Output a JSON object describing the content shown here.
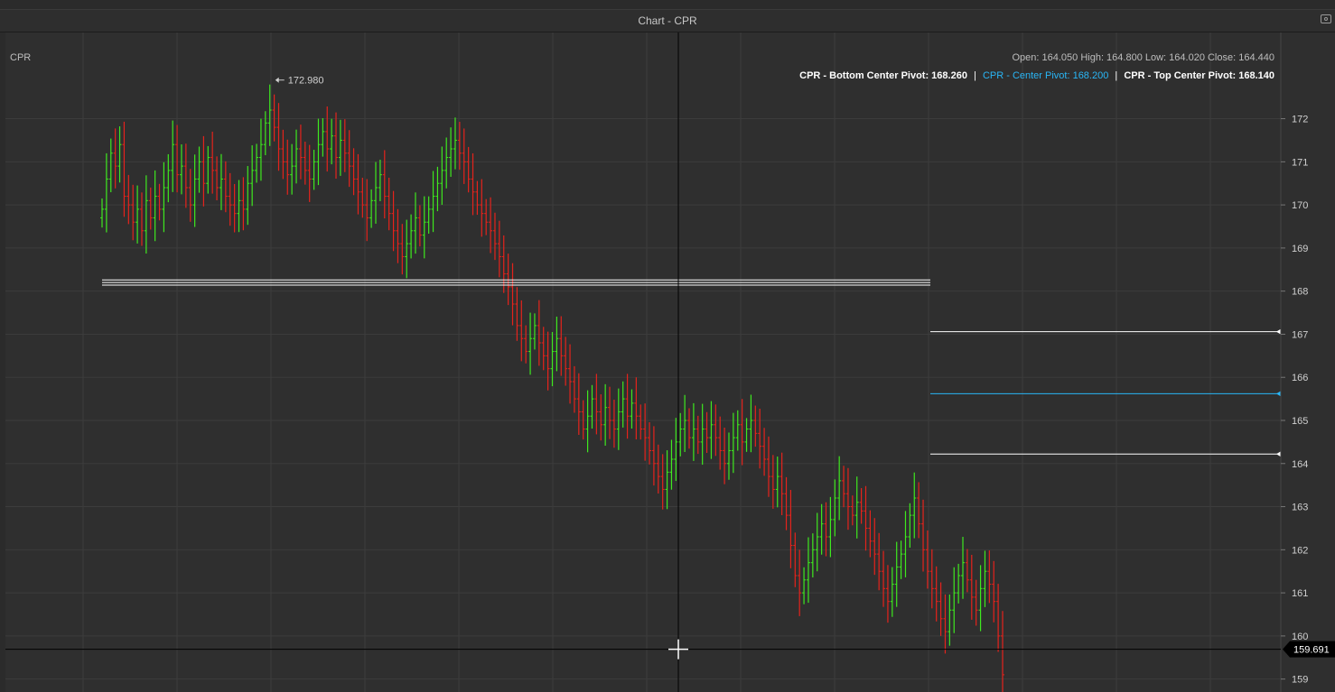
{
  "window": {
    "title": "Chart - CPR",
    "screenshot_icon": "camera-icon"
  },
  "legend": {
    "name": "CPR",
    "ohlc": "Open: 164.050 High: 164.800 Low: 164.020 Close: 164.440",
    "bottom_pivot": "CPR - Bottom Center Pivot: 168.260",
    "center_pivot": "CPR - Center Pivot: 168.200",
    "top_pivot": "CPR - Top Center Pivot: 168.140",
    "separator": "|"
  },
  "colors": {
    "up": "#3ee81f",
    "down": "#e5231c",
    "white_line": "#ffffff",
    "blue_line": "#29b6f6",
    "grid": "#3c3c3c",
    "background": "#2f2f2f"
  },
  "chart_data": {
    "type": "candlestick-ohlc",
    "title": "",
    "y_ticks": [
      172,
      171,
      170,
      169,
      168,
      167,
      166,
      165,
      164,
      163,
      162,
      161,
      160,
      159
    ],
    "y_range": [
      158.7,
      174.0
    ],
    "annotations": {
      "high_marker": "172.980"
    },
    "cursor": {
      "price_label": "159.691",
      "price": 159.691
    },
    "pivot_lines_current": [
      {
        "name": "CPR - Bottom Center Pivot",
        "value": 168.26,
        "color": "#ffffff"
      },
      {
        "name": "CPR - Center Pivot",
        "value": 168.2,
        "color": "#ffffff"
      },
      {
        "name": "CPR - Top Center Pivot",
        "value": 168.14,
        "color": "#ffffff"
      }
    ],
    "pivot_lines_next": [
      {
        "value": 167.06,
        "color": "#ffffff"
      },
      {
        "value": 165.62,
        "color": "#29b6f6"
      },
      {
        "value": 164.22,
        "color": "#ffffff"
      }
    ],
    "closes": [
      169.9,
      170.6,
      171.2,
      170.9,
      171.4,
      170.2,
      170.0,
      169.6,
      169.9,
      169.4,
      170.1,
      169.7,
      170.2,
      169.9,
      170.4,
      170.8,
      171.4,
      170.7,
      170.9,
      170.4,
      170.0,
      170.6,
      171.0,
      170.5,
      171.1,
      170.8,
      170.4,
      170.6,
      170.2,
      170.0,
      169.8,
      170.1,
      169.9,
      170.5,
      170.8,
      171.1,
      171.4,
      171.9,
      172.2,
      171.8,
      171.3,
      171.0,
      170.7,
      170.9,
      171.3,
      171.1,
      170.8,
      170.6,
      171.0,
      171.4,
      171.7,
      171.3,
      171.6,
      171.1,
      171.5,
      171.2,
      170.9,
      170.6,
      170.3,
      170.0,
      169.7,
      170.1,
      170.4,
      170.7,
      170.2,
      169.8,
      169.4,
      169.1,
      168.8,
      169.1,
      169.4,
      169.7,
      169.3,
      169.6,
      169.9,
      170.2,
      170.5,
      170.8,
      171.1,
      171.3,
      171.5,
      171.2,
      171.0,
      170.6,
      170.3,
      170.0,
      169.8,
      169.6,
      169.4,
      169.1,
      168.8,
      168.4,
      168.1,
      167.7,
      167.2,
      166.9,
      166.6,
      166.9,
      167.2,
      166.8,
      166.5,
      166.2,
      166.6,
      166.9,
      166.5,
      166.2,
      165.9,
      165.5,
      165.2,
      164.8,
      165.1,
      165.5,
      165.2,
      164.9,
      165.3,
      165.0,
      164.8,
      165.2,
      165.5,
      165.1,
      165.4,
      165.1,
      164.8,
      164.6,
      164.3,
      164.0,
      163.7,
      163.4,
      163.8,
      164.1,
      164.5,
      164.8,
      165.0,
      164.6,
      164.8,
      164.5,
      164.8,
      164.6,
      164.9,
      164.6,
      164.3,
      164.0,
      164.3,
      164.6,
      164.9,
      164.5,
      164.8,
      165.0,
      164.7,
      164.4,
      164.1,
      163.7,
      163.4,
      163.7,
      163.3,
      162.8,
      162.1,
      161.4,
      161.0,
      161.3,
      161.7,
      162.0,
      162.3,
      162.6,
      162.3,
      162.7,
      163.2,
      163.6,
      163.3,
      163.0,
      162.8,
      163.1,
      162.9,
      162.5,
      162.2,
      161.9,
      161.5,
      161.1,
      160.8,
      161.2,
      161.6,
      161.9,
      162.3,
      162.8,
      163.2,
      162.6,
      162.0,
      161.5,
      161.1,
      160.8,
      160.4,
      160.1,
      160.6,
      161.0,
      161.4,
      161.7,
      161.3,
      160.9,
      160.6,
      161.1,
      161.5,
      161.2,
      160.8,
      160.0,
      159.1
    ]
  }
}
